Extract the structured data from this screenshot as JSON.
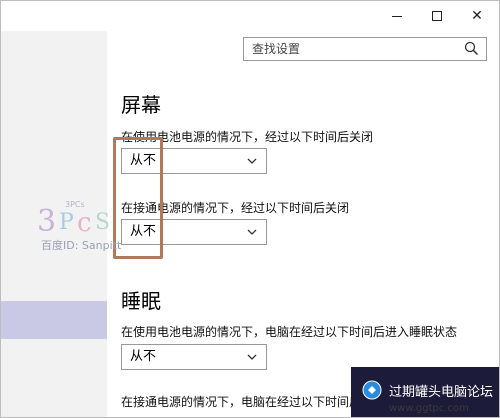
{
  "window": {
    "controls": {
      "minimize": "minimize",
      "maximize": "maximize",
      "close": "✕"
    }
  },
  "search": {
    "placeholder": "查找设置"
  },
  "screen_section": {
    "title": "屏幕",
    "battery_label": "在使用电池电源的情况下，经过以下时间后关闭",
    "battery_value": "从不",
    "plugged_label": "在接通电源的情况下，经过以下时间后关闭",
    "plugged_value": "从不"
  },
  "sleep_section": {
    "title": "睡眠",
    "battery_label": "在使用电池电源的情况下，电脑在经过以下时间后进入睡眠状态",
    "battery_value": "从不",
    "plugged_label": "在接通电源的情况下，电脑在经过以下时间后进入睡眠状态"
  },
  "watermark": {
    "text": "百度ID: Sanpitt"
  },
  "forum": {
    "name": "过期罐头电脑论坛",
    "url": "www.ggtpc.com"
  },
  "colors": {
    "highlight_border": "#b07a5a",
    "sidebar_selected": "#c9c9e6"
  }
}
